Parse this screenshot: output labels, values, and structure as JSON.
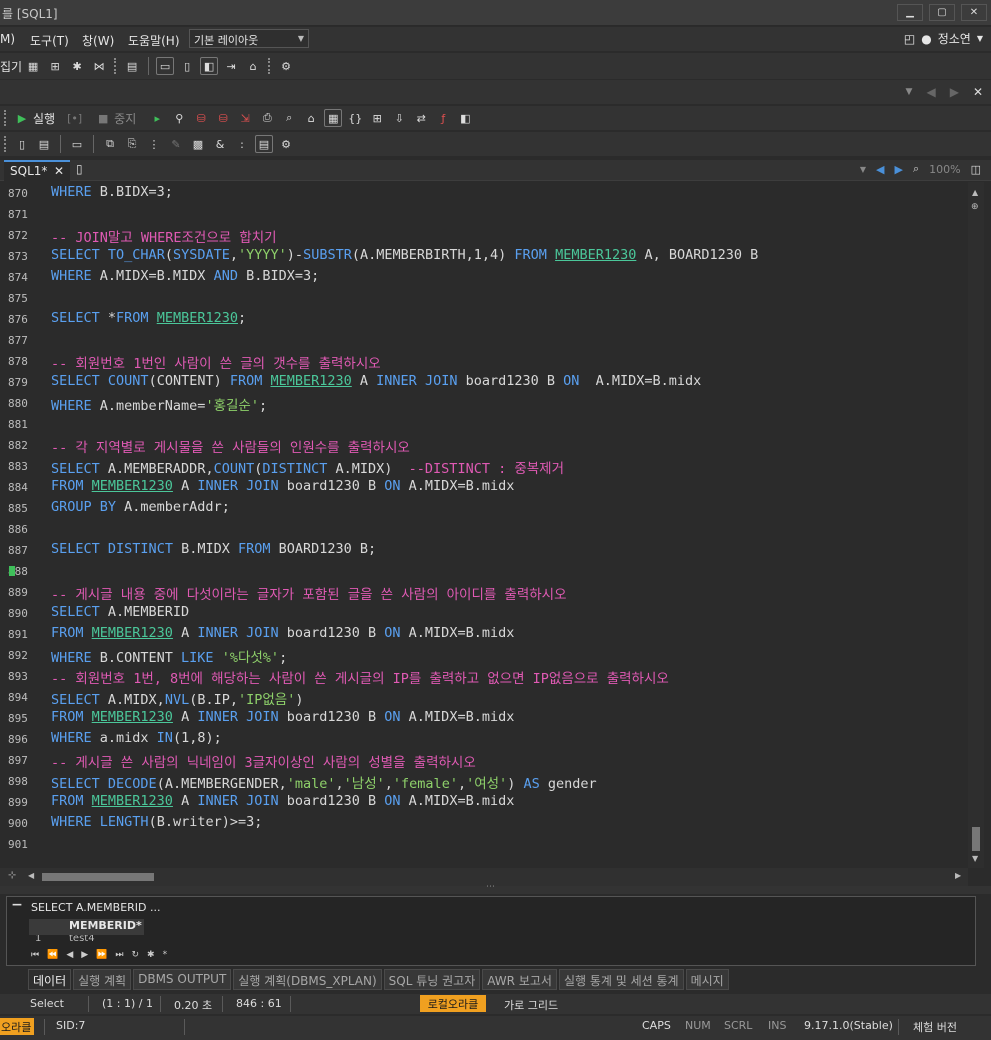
{
  "window": {
    "title": "를 [SQL1]",
    "minimize": "▁",
    "restore": "▢",
    "close": "✕"
  },
  "menu": {
    "items": [
      "M)",
      "도구(T)",
      "창(W)",
      "도움말(H)"
    ],
    "layout_value": "기본 레이아웃",
    "user": "정소연"
  },
  "toolbar1": {
    "label": "집기"
  },
  "toolbar2": {
    "run": "실행",
    "stop": "중지",
    "brackets": "[•]"
  },
  "tabs": {
    "active": "SQL1*",
    "zoom": "100%"
  },
  "editor": {
    "lines": [
      {
        "n": "870",
        "t": [
          [
            "kw",
            "WHERE"
          ],
          [
            "plain",
            " B.BIDX=3;"
          ]
        ]
      },
      {
        "n": "871",
        "t": []
      },
      {
        "n": "872",
        "t": [
          [
            "cm",
            "-- JOIN말고 WHERE조건으로 합치기"
          ]
        ]
      },
      {
        "n": "873",
        "t": [
          [
            "kw",
            "SELECT"
          ],
          [
            "plain",
            " "
          ],
          [
            "fn",
            "TO_CHAR"
          ],
          [
            "plain",
            "("
          ],
          [
            "fn",
            "SYSDATE"
          ],
          [
            "plain",
            ","
          ],
          [
            "str",
            "'YYYY'"
          ],
          [
            "plain",
            ")-"
          ],
          [
            "fn",
            "SUBSTR"
          ],
          [
            "plain",
            "(A.MEMBERBIRTH,1,4) "
          ],
          [
            "kw",
            "FROM"
          ],
          [
            "plain",
            " "
          ],
          [
            "tbl",
            "MEMBER1230"
          ],
          [
            "plain",
            " A, BOARD1230 B"
          ]
        ]
      },
      {
        "n": "874",
        "t": [
          [
            "kw",
            "WHERE"
          ],
          [
            "plain",
            " A.MIDX=B.MIDX "
          ],
          [
            "kw",
            "AND"
          ],
          [
            "plain",
            " B.BIDX=3;"
          ]
        ]
      },
      {
        "n": "875",
        "t": []
      },
      {
        "n": "876",
        "t": [
          [
            "kw",
            "SELECT"
          ],
          [
            "plain",
            " *"
          ],
          [
            "kw",
            "FROM"
          ],
          [
            "plain",
            " "
          ],
          [
            "tbl",
            "MEMBER1230"
          ],
          [
            "plain",
            ";"
          ]
        ]
      },
      {
        "n": "877",
        "t": []
      },
      {
        "n": "878",
        "t": [
          [
            "cm",
            "-- 회원번호 1번인 사람이 쓴 글의 갯수를 출력하시오"
          ]
        ]
      },
      {
        "n": "879",
        "t": [
          [
            "kw",
            "SELECT"
          ],
          [
            "plain",
            " "
          ],
          [
            "fn",
            "COUNT"
          ],
          [
            "plain",
            "(CONTENT) "
          ],
          [
            "kw",
            "FROM"
          ],
          [
            "plain",
            " "
          ],
          [
            "tbl",
            "MEMBER1230"
          ],
          [
            "plain",
            " A "
          ],
          [
            "kw",
            "INNER JOIN"
          ],
          [
            "plain",
            " board1230 B "
          ],
          [
            "kw",
            "ON"
          ],
          [
            "plain",
            "  A.MIDX=B.midx"
          ]
        ]
      },
      {
        "n": "880",
        "t": [
          [
            "kw",
            "WHERE"
          ],
          [
            "plain",
            " A.memberName="
          ],
          [
            "str",
            "'홍길순'"
          ],
          [
            "plain",
            ";"
          ]
        ]
      },
      {
        "n": "881",
        "t": []
      },
      {
        "n": "882",
        "t": [
          [
            "cm",
            "-- 각 지역별로 게시물을 쓴 사람들의 인원수를 출력하시오"
          ]
        ]
      },
      {
        "n": "883",
        "t": [
          [
            "kw",
            "SELECT"
          ],
          [
            "plain",
            " A.MEMBERADDR,"
          ],
          [
            "fn",
            "COUNT"
          ],
          [
            "plain",
            "("
          ],
          [
            "kw",
            "DISTINCT"
          ],
          [
            "plain",
            " A.MIDX)  "
          ],
          [
            "cm",
            "--DISTINCT : 중복제거"
          ]
        ]
      },
      {
        "n": "884",
        "t": [
          [
            "kw",
            "FROM"
          ],
          [
            "plain",
            " "
          ],
          [
            "tbl",
            "MEMBER1230"
          ],
          [
            "plain",
            " A "
          ],
          [
            "kw",
            "INNER JOIN"
          ],
          [
            "plain",
            " board1230 B "
          ],
          [
            "kw",
            "ON"
          ],
          [
            "plain",
            " A.MIDX=B.midx"
          ]
        ]
      },
      {
        "n": "885",
        "t": [
          [
            "kw",
            "GROUP BY"
          ],
          [
            "plain",
            " A.memberAddr;"
          ]
        ]
      },
      {
        "n": "886",
        "t": []
      },
      {
        "n": "887",
        "t": [
          [
            "kw",
            "SELECT"
          ],
          [
            "plain",
            " "
          ],
          [
            "kw",
            "DISTINCT"
          ],
          [
            "plain",
            " B.MIDX "
          ],
          [
            "kw",
            "FROM"
          ],
          [
            "plain",
            " BOARD1230 B;"
          ]
        ]
      },
      {
        "n": "888",
        "t": []
      },
      {
        "n": "889",
        "t": [
          [
            "cm",
            "-- 게시글 내용 중에 다섯이라는 글자가 포함된 글을 쓴 사람의 아이디를 출력하시오"
          ]
        ]
      },
      {
        "n": "890",
        "t": [
          [
            "kw",
            "SELECT"
          ],
          [
            "plain",
            " A.MEMBERID"
          ]
        ]
      },
      {
        "n": "891",
        "t": [
          [
            "kw",
            "FROM"
          ],
          [
            "plain",
            " "
          ],
          [
            "tbl",
            "MEMBER1230"
          ],
          [
            "plain",
            " A "
          ],
          [
            "kw",
            "INNER JOIN"
          ],
          [
            "plain",
            " board1230 B "
          ],
          [
            "kw",
            "ON"
          ],
          [
            "plain",
            " A.MIDX=B.midx"
          ]
        ]
      },
      {
        "n": "892",
        "t": [
          [
            "kw",
            "WHERE"
          ],
          [
            "plain",
            " B.CONTENT "
          ],
          [
            "kw",
            "LIKE"
          ],
          [
            "plain",
            " "
          ],
          [
            "str",
            "'%다섯%'"
          ],
          [
            "plain",
            ";"
          ]
        ]
      },
      {
        "n": "893",
        "t": [
          [
            "cm",
            "-- 회원번호 1번, 8번에 해당하는 사람이 쓴 게시글의 IP를 출력하고 없으면 IP없음으로 출력하시오"
          ]
        ]
      },
      {
        "n": "894",
        "t": [
          [
            "kw",
            "SELECT"
          ],
          [
            "plain",
            " A.MIDX,"
          ],
          [
            "fn",
            "NVL"
          ],
          [
            "plain",
            "(B.IP,"
          ],
          [
            "str",
            "'IP없음'"
          ],
          [
            "plain",
            ")"
          ]
        ]
      },
      {
        "n": "895",
        "t": [
          [
            "kw",
            "FROM"
          ],
          [
            "plain",
            " "
          ],
          [
            "tbl",
            "MEMBER1230"
          ],
          [
            "plain",
            " A "
          ],
          [
            "kw",
            "INNER JOIN"
          ],
          [
            "plain",
            " board1230 B "
          ],
          [
            "kw",
            "ON"
          ],
          [
            "plain",
            " A.MIDX=B.midx"
          ]
        ]
      },
      {
        "n": "896",
        "t": [
          [
            "kw",
            "WHERE"
          ],
          [
            "plain",
            " a.midx "
          ],
          [
            "kw",
            "IN"
          ],
          [
            "plain",
            "(1,8);"
          ]
        ]
      },
      {
        "n": "897",
        "t": [
          [
            "cm",
            "-- 게시글 쓴 사람의 닉네임이 3글자이상인 사람의 성별을 출력하시오"
          ]
        ]
      },
      {
        "n": "898",
        "t": [
          [
            "kw",
            "SELECT"
          ],
          [
            "plain",
            " "
          ],
          [
            "fn",
            "DECODE"
          ],
          [
            "plain",
            "(A.MEMBERGENDER,"
          ],
          [
            "str",
            "'male'"
          ],
          [
            "plain",
            ","
          ],
          [
            "str",
            "'남성'"
          ],
          [
            "plain",
            ","
          ],
          [
            "str",
            "'female'"
          ],
          [
            "plain",
            ","
          ],
          [
            "str",
            "'여성'"
          ],
          [
            "plain",
            ") "
          ],
          [
            "kw",
            "AS"
          ],
          [
            "plain",
            " gender"
          ]
        ]
      },
      {
        "n": "899",
        "t": [
          [
            "kw",
            "FROM"
          ],
          [
            "plain",
            " "
          ],
          [
            "tbl",
            "MEMBER1230"
          ],
          [
            "plain",
            " A "
          ],
          [
            "kw",
            "INNER JOIN"
          ],
          [
            "plain",
            " board1230 B "
          ],
          [
            "kw",
            "ON"
          ],
          [
            "plain",
            " A.MIDX=B.midx"
          ]
        ]
      },
      {
        "n": "900",
        "t": [
          [
            "kw",
            "WHERE"
          ],
          [
            "plain",
            " "
          ],
          [
            "fn",
            "LENGTH"
          ],
          [
            "plain",
            "(B.writer)>=3;"
          ]
        ]
      },
      {
        "n": "901",
        "t": []
      }
    ]
  },
  "result": {
    "query_label": "SELECT A.MEMBERID ...",
    "column": "MEMBERID*",
    "row_num": "1",
    "row_value": "test4"
  },
  "bottom_tabs": [
    "데이터",
    "실행 계획",
    "DBMS OUTPUT",
    "실행 계획(DBMS_XPLAN)",
    "SQL 튜닝 권고자",
    "AWR 보고서",
    "실행 통계 및 세션 통계",
    "메시지"
  ],
  "status1": {
    "mode": "Select",
    "position": "(1 : 1) / 1",
    "elapsed": "0.20 초",
    "cursor": "846 : 61",
    "connection": "로컬오라클",
    "grid": "가로 그리드"
  },
  "status2": {
    "connection": "오라클",
    "sid": "SID:7",
    "caps": "CAPS",
    "num": "NUM",
    "scrl": "SCRL",
    "ins": "INS",
    "version": "9.17.1.0(Stable)",
    "edition": "체험 버전"
  },
  "colors": {
    "keyword": "#5aa0f0",
    "string": "#8ed06a",
    "comment": "#e05ab4",
    "table": "#4bc79a",
    "connection_badge": "#f0a020"
  }
}
